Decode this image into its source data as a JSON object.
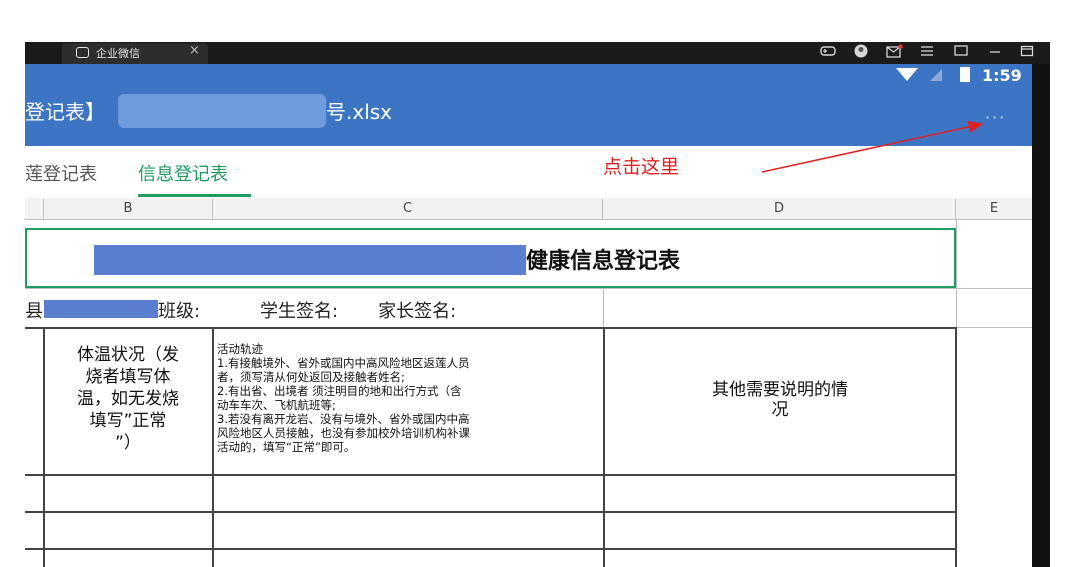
{
  "window": {
    "tab_title": "企业微信",
    "tab_close": "×"
  },
  "status_bar": {
    "time": "1:59"
  },
  "header": {
    "file_title_prefix": "登记表】",
    "file_title_suffix": "号.xlsx",
    "more_label": "···"
  },
  "sheet_tabs": [
    {
      "label": "莲登记表",
      "active": false
    },
    {
      "label": "信息登记表",
      "active": true
    }
  ],
  "annotation": {
    "text": "点击这里",
    "color": "#e02020"
  },
  "columns": [
    "B",
    "C",
    "D",
    "E"
  ],
  "sheet": {
    "title": "健康信息登记表",
    "row3": {
      "prefix": "县",
      "class_label": "班级:",
      "sign_labels": "学生签名:       家长签名:"
    },
    "header_b": [
      "体温状况（发",
      "烧者填写体",
      "温，如无发烧",
      "填写”正常",
      "”）"
    ],
    "header_c": [
      "活动轨迹",
      "1.有接触境外、省外或国内中高风险地区返莲人员",
      "者，须写清从何处返回及接触者姓名;",
      "2.有出省、出境者 须注明目的地和出行方式（含",
      "动车车次、飞机航班等;",
      "3.若没有离开龙岩、没有与境外、省外或国内中高",
      "风险地区人员接触，也没有参加校外培训机构补课",
      "活动的，填写“正常”即可。"
    ],
    "header_d": [
      "其他需要说明的情",
      "况"
    ]
  },
  "colors": {
    "appbar": "#3d75c5",
    "active_tab": "#1f9d60"
  }
}
